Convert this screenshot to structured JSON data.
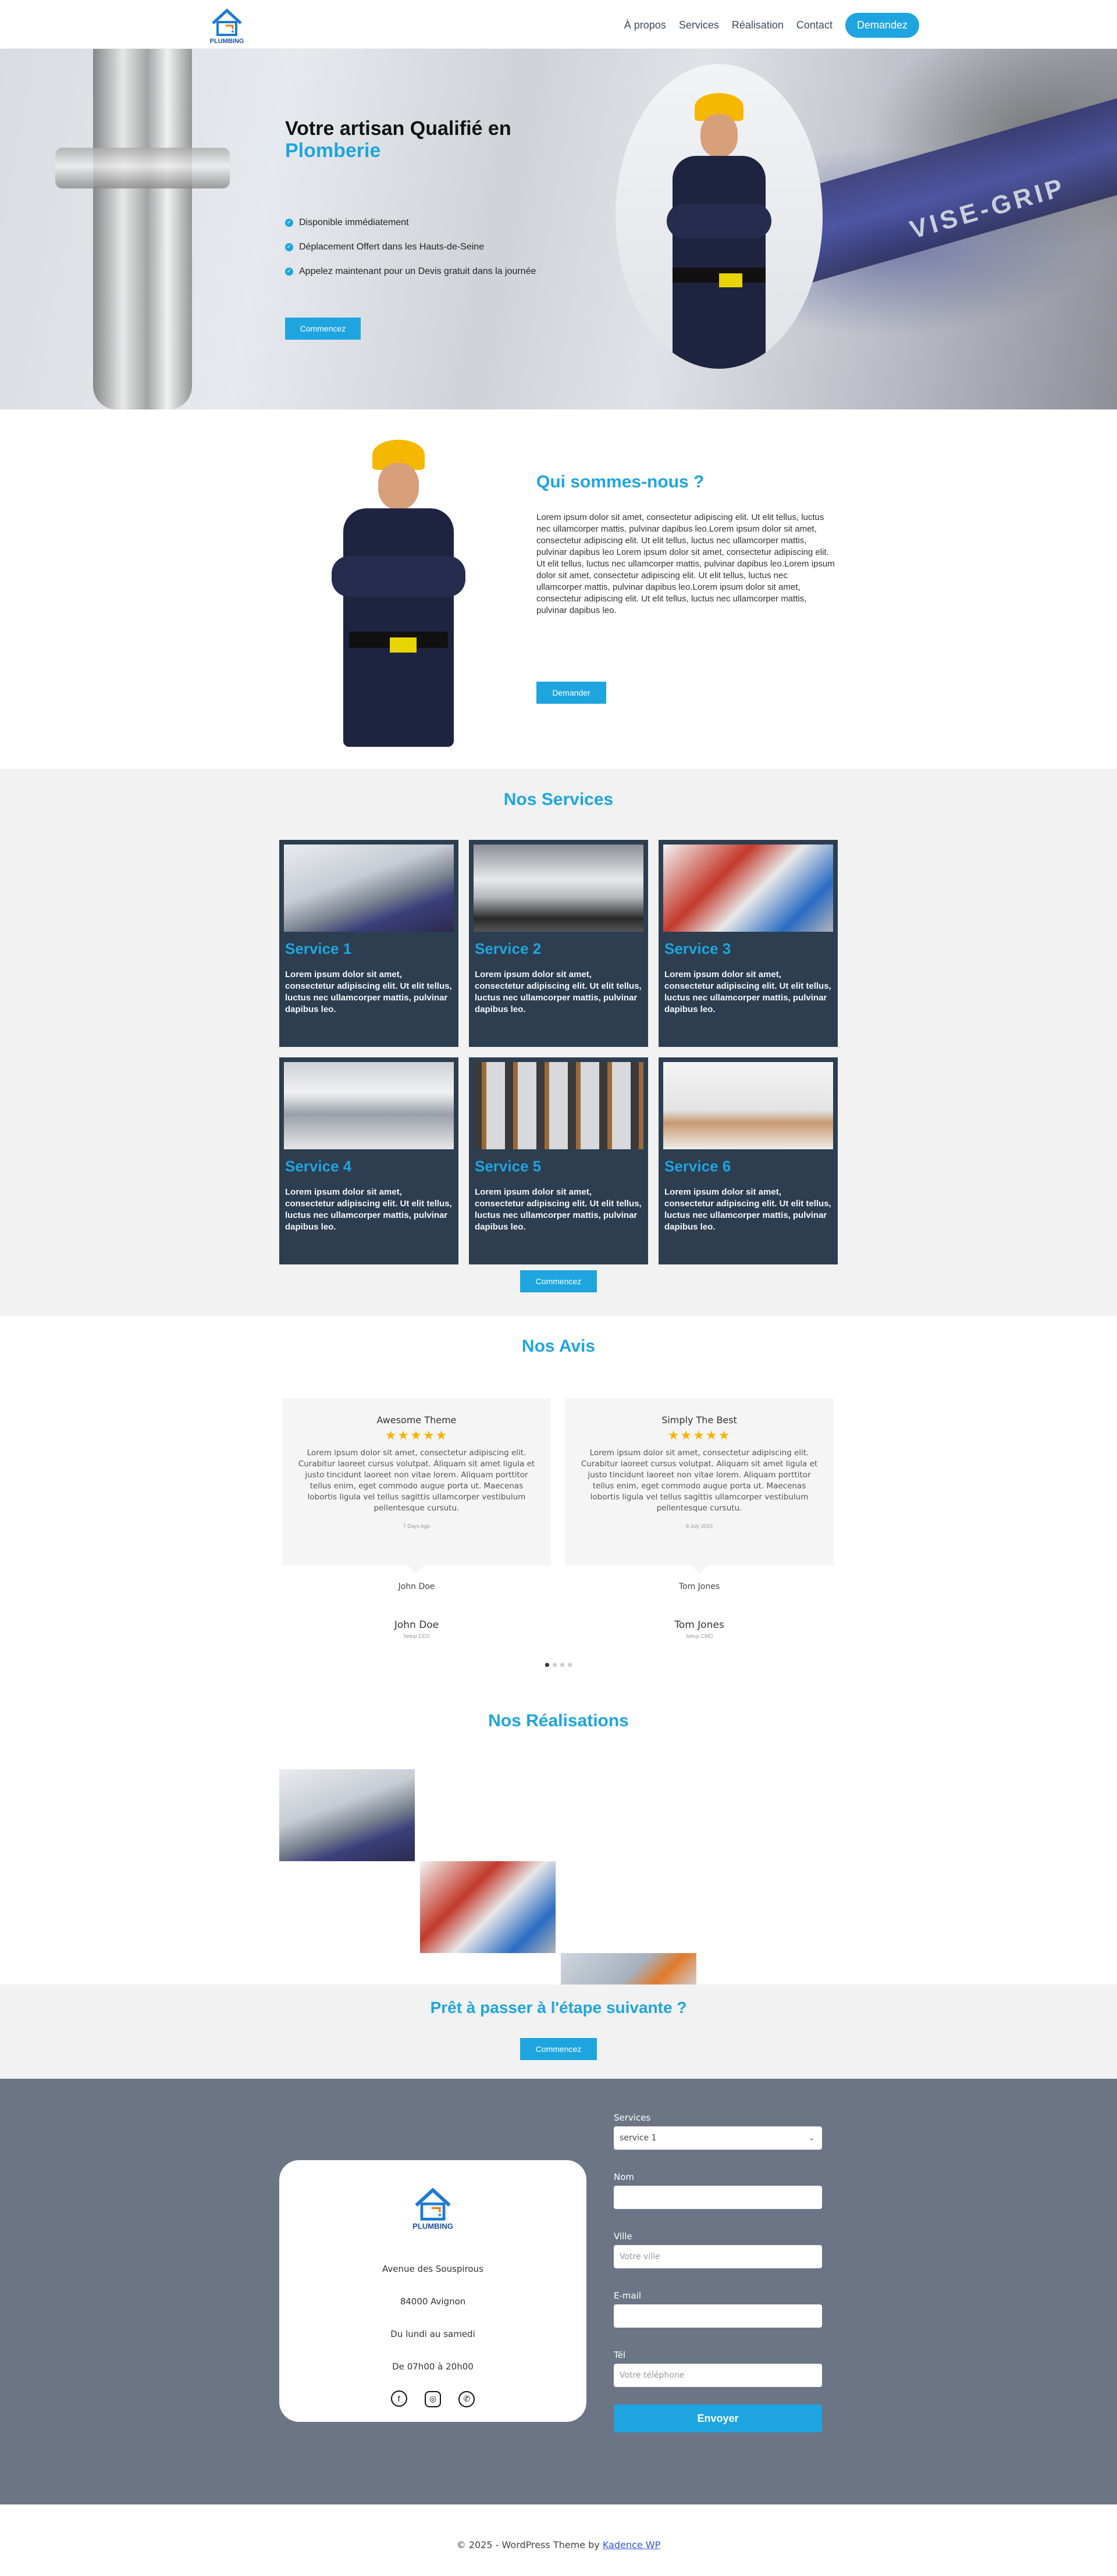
{
  "header": {
    "logo_text": "PLUMBING",
    "nav": [
      "À propos",
      "Services",
      "Réalisation",
      "Contact"
    ],
    "cta_label": "Demandez"
  },
  "hero": {
    "title_line1": "Votre artisan Qualifié en",
    "title_line2": "Plomberie",
    "checks": [
      "Disponible immédiatement",
      "Déplacement Offert dans les Hauts-de-Seine",
      "Appelez maintenant pour un Devis gratuit  dans la journée"
    ],
    "button_label": "Commencez",
    "brand_text": "VISE-GRIP"
  },
  "about": {
    "title": "Qui sommes-nous ?",
    "text": "Lorem ipsum dolor sit amet, consectetur adipiscing elit. Ut elit tellus, luctus nec ullamcorper mattis, pulvinar dapibus leo.Lorem ipsum dolor sit amet, consectetur adipiscing elit. Ut elit tellus, luctus nec ullamcorper mattis, pulvinar dapibus leo Lorem ipsum dolor sit amet, consectetur adipiscing elit. Ut elit tellus, luctus nec ullamcorper mattis, pulvinar dapibus leo.Lorem ipsum dolor sit amet, consectetur adipiscing elit. Ut elit tellus, luctus nec ullamcorper mattis, pulvinar dapibus leo.Lorem ipsum dolor sit amet, consectetur adipiscing elit. Ut elit tellus, luctus nec ullamcorper mattis, pulvinar dapibus leo.",
    "button_label": "Demander"
  },
  "services": {
    "title": "Nos Services",
    "items": [
      {
        "title": "Service 1",
        "text": "Lorem ipsum dolor sit amet, consectetur adipiscing elit. Ut elit tellus, luctus nec ullamcorper mattis, pulvinar dapibus leo."
      },
      {
        "title": "Service 2",
        "text": "Lorem ipsum dolor sit amet, consectetur adipiscing elit. Ut elit tellus, luctus nec ullamcorper mattis, pulvinar dapibus leo."
      },
      {
        "title": "Service 3",
        "text": "Lorem ipsum dolor sit amet, consectetur adipiscing elit. Ut elit tellus, luctus nec ullamcorper mattis, pulvinar dapibus leo."
      },
      {
        "title": "Service 4",
        "text": "Lorem ipsum dolor sit amet, consectetur adipiscing elit. Ut elit tellus, luctus nec ullamcorper mattis, pulvinar dapibus leo."
      },
      {
        "title": "Service 5",
        "text": "Lorem ipsum dolor sit amet, consectetur adipiscing elit. Ut elit tellus, luctus nec ullamcorper mattis, pulvinar dapibus leo."
      },
      {
        "title": "Service 6",
        "text": "Lorem ipsum dolor sit amet, consectetur adipiscing elit. Ut elit tellus, luctus nec ullamcorper mattis, pulvinar dapibus leo."
      }
    ],
    "button_label": "Commencez"
  },
  "reviews": {
    "title": "Nos Avis",
    "items": [
      {
        "title": "Awesome Theme",
        "stars": "★★★★★",
        "rating": 4.5,
        "text": "Lorem ipsum dolor sit amet, consectetur adipiscing elit. Curabitur laoreet cursus volutpat. Aliquam sit amet ligula et justo tincidunt laoreet non vitae lorem. Aliquam porttitor tellus enim, eget commodo augue porta ut. Maecenas lobortis ligula vel tellus sagittis ullamcorper vestibulum pellentesque cursutu.",
        "date": "7 Days Ago",
        "avatar_alt": "John Doe",
        "name": "John Doe",
        "role": "Setup CEO"
      },
      {
        "title": "Simply The Best",
        "stars": "★★★★★",
        "rating": 5,
        "text": "Lorem ipsum dolor sit amet, consectetur adipiscing elit. Curabitur laoreet cursus volutpat. Aliquam sit amet ligula et justo tincidunt laoreet non vitae lorem. Aliquam porttitor tellus enim, eget commodo augue porta ut. Maecenas lobortis ligula vel tellus sagittis ullamcorper vestibulum pellentesque cursutu.",
        "date": "8 July 2019",
        "avatar_alt": "Tom Jones",
        "name": "Tom Jones",
        "role": "Setup CMO"
      }
    ],
    "dots": 4,
    "active_dot": 1
  },
  "gallery": {
    "title": "Nos Réalisations"
  },
  "cta": {
    "title": "Prêt à passer à l'étape suivante ?",
    "button_label": "Commencez"
  },
  "contact": {
    "logo_text": "PLUMBING",
    "address": "Avenue des Souspirous",
    "city": "84000 Avignon",
    "days": "Du lundi au samedi",
    "hours": "De 07h00 à 20h00",
    "form": {
      "services_label": "Services",
      "services_value": "service 1",
      "nom_label": "Nom",
      "ville_label": "Ville",
      "ville_placeholder": "Votre ville",
      "email_label": "E-mail",
      "tel_label": "Tél",
      "tel_placeholder": "Votre téléphone",
      "submit_label": "Envoyer"
    }
  },
  "footer": {
    "text": "© 2025 - WordPress Theme by ",
    "link": "Kadence WP"
  },
  "colors": {
    "accent": "#1ea5e0",
    "card_bg": "#2c3e50",
    "contact_bg": "#6b7585",
    "star": "#f5b400"
  }
}
